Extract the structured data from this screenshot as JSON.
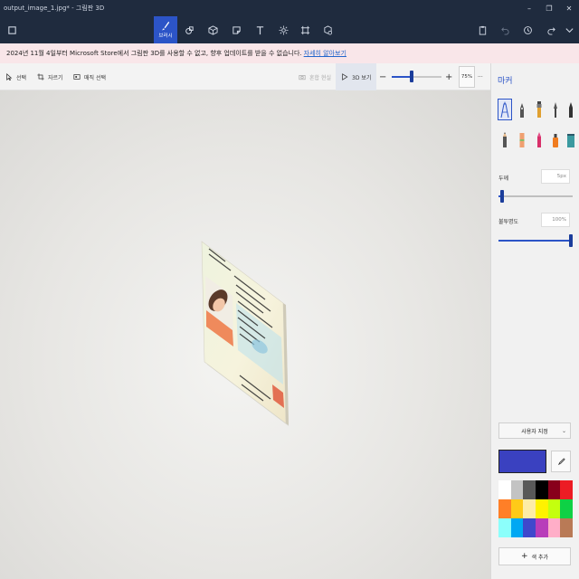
{
  "window": {
    "title": "output_image_1.jpg* - 그림판 3D",
    "minimize": "–",
    "maximize": "❐",
    "close": "✕"
  },
  "ribbon": {
    "active_label": "브러시",
    "tools": [
      "menu-icon",
      "brush-icon",
      "2d-shapes-icon",
      "3d-shapes-icon",
      "stickers-icon",
      "text-icon",
      "effects-icon",
      "canvas-icon",
      "3d-library-icon"
    ],
    "right_tools": [
      "paste-icon",
      "undo-icon",
      "history-icon",
      "redo-icon",
      "expand-icon"
    ]
  },
  "banner": {
    "text": "2024년 11월 4일부터 Microsoft Store에서 그림판 3D를 사용할 수 없고, 향후 업데이트를 받을 수 없습니다.",
    "link": "자세히 알아보기"
  },
  "canvas_toolbar": {
    "select": "선택",
    "crop": "자르기",
    "magic_select": "매직 선택",
    "mixed_reality": "혼합 현실",
    "view_3d": "3D 보기",
    "zoom_minus": "−",
    "zoom_plus": "+",
    "zoom": "75%",
    "zoom_fraction": 0.4,
    "more": "···"
  },
  "panel": {
    "title": "마커",
    "brushes": [
      "marker-icon",
      "calligraphy-pen-icon",
      "oil-brush-icon",
      "watercolor-icon",
      "pixel-pen-icon",
      "pencil-icon",
      "eraser-icon",
      "crayon-icon",
      "spray-can-icon",
      "fill-icon"
    ],
    "thickness_label": "두께",
    "thickness_value": "5px",
    "thickness_fraction": 0.05,
    "opacity_label": "불투명도",
    "opacity_value": "100%",
    "opacity_fraction": 1.0,
    "color_mode": "사용자 지정",
    "current_color": "#3a41c0",
    "swatches": [
      "#ffffff",
      "#c3c3c3",
      "#585858",
      "#000000",
      "#88001b",
      "#ec1c24",
      "#ff7f27",
      "#ffca18",
      "#fdeca6",
      "#fff200",
      "#c4ff0e",
      "#0ed145",
      "#8cfffb",
      "#00a8f3",
      "#3f48cc",
      "#b83dba",
      "#ffaec8",
      "#b97a56"
    ],
    "add_color": "색 추가"
  }
}
